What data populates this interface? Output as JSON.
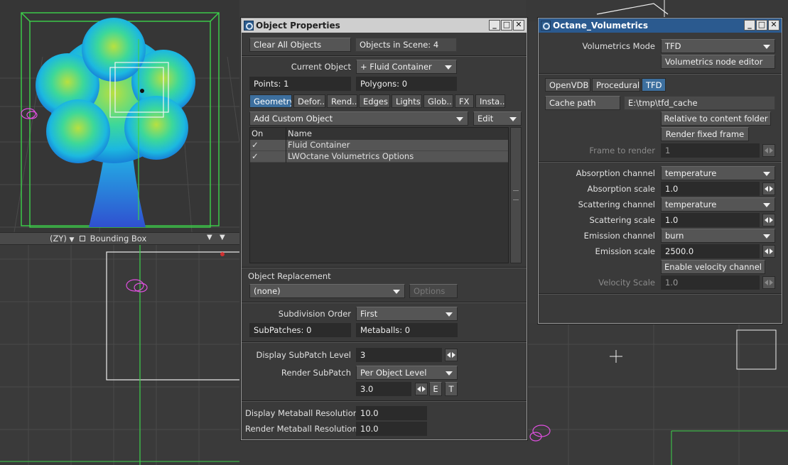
{
  "viewport": {
    "view_label": "(ZY)",
    "shading_mode": "Bounding Box"
  },
  "object_properties": {
    "title": "Object Properties",
    "clear_all": "Clear All Objects",
    "objects_in_scene": "Objects in Scene: 4",
    "current_object_label": "Current Object",
    "current_object_value": "Fluid Container",
    "points": "Points: 1",
    "polygons": "Polygons: 0",
    "tabs": [
      "Geometry",
      "Defor...",
      "Rend...",
      "Edges",
      "Lights",
      "Glob...",
      "FX",
      "Insta..."
    ],
    "add_custom_object": "Add Custom Object",
    "edit": "Edit",
    "col_on": "On",
    "col_name": "Name",
    "rows": [
      {
        "on": "✓",
        "name": "Fluid Container"
      },
      {
        "on": "✓",
        "name": "LWOctane Volumetrics Options"
      }
    ],
    "object_replacement_label": "Object Replacement",
    "object_replacement_value": "(none)",
    "options": "Options",
    "subdivision_order_label": "Subdivision Order",
    "subdivision_order_value": "First",
    "subpatches": "SubPatches: 0",
    "metaballs": "Metaballs: 0",
    "display_subpatch_label": "Display SubPatch Level",
    "display_subpatch_value": "3",
    "render_subpatch_label": "Render SubPatch",
    "render_subpatch_value": "Per Object Level",
    "render_subpatch_num": "3.0",
    "e_btn": "E",
    "t_btn": "T",
    "display_metaball_label": "Display Metaball Resolution",
    "display_metaball_value": "10.0",
    "render_metaball_label": "Render Metaball Resolution",
    "render_metaball_value": "10.0"
  },
  "octane": {
    "title": "Octane_Volumetrics",
    "mode_label": "Volumetrics Mode",
    "mode_value": "TFD",
    "node_editor": "Volumetrics node editor",
    "tabs": [
      "OpenVDB",
      "Procedural",
      "TFD"
    ],
    "cache_path_btn": "Cache path",
    "cache_path_value": "E:\\tmp\\tfd_cache",
    "relative": "Relative to content folder",
    "render_fixed": "Render fixed frame",
    "frame_label": "Frame to render",
    "frame_value": "1",
    "absorption_channel_label": "Absorption channel",
    "absorption_channel_value": "temperature",
    "absorption_scale_label": "Absorption scale",
    "absorption_scale_value": "1.0",
    "scattering_channel_label": "Scattering channel",
    "scattering_channel_value": "temperature",
    "scattering_scale_label": "Scattering scale",
    "scattering_scale_value": "1.0",
    "emission_channel_label": "Emission channel",
    "emission_channel_value": "burn",
    "emission_scale_label": "Emission scale",
    "emission_scale_value": "2500.0",
    "velocity_btn": "Enable velocity channel",
    "velocity_scale_label": "Velocity Scale",
    "velocity_scale_value": "1.0"
  }
}
